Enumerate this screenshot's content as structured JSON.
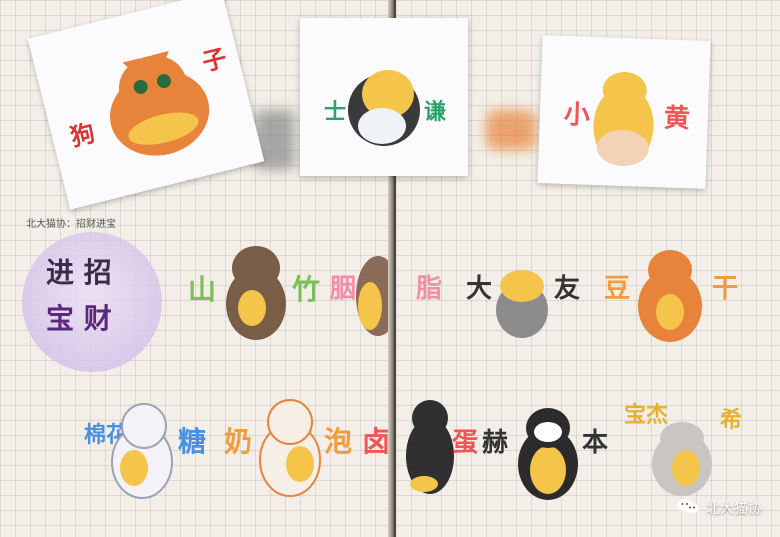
{
  "image": {
    "width": 780,
    "height": 537
  },
  "texts": {
    "note_title": "北大猫协：招财进宝",
    "sticker_1_left": "狗",
    "sticker_1_right": "子",
    "sticker_2_left": "士",
    "sticker_2_right": "谦",
    "sticker_3_left": "小",
    "sticker_3_right": "黄",
    "circle_top": "进 招",
    "circle_bottom": "宝 财",
    "row1_1_left": "山",
    "row1_1_right": "竹",
    "row1_2_left": "胭",
    "row1_2_right": "脂",
    "row1_3_left": "大",
    "row1_3_right": "友",
    "row1_4_left": "豆",
    "row1_4_right": "干",
    "row2_1_left": "棉花",
    "row2_1_right": "糖",
    "row2_2_left": "奶",
    "row2_2_right": "泡",
    "row2_3_left": "卤",
    "row2_3_right": "蛋",
    "row2_4_left": "赫",
    "row2_4_right": "本",
    "row2_5_left": "宝杰",
    "row2_5_right": "希",
    "watermark": "北大猫协"
  },
  "colors": {
    "paper": "#f3efe8",
    "grid": "#c9c2b7",
    "gutter_dark": "#3b3632",
    "orange_cat": "#e7833a",
    "purple_circle": "#d6c3ea"
  },
  "icons": {
    "watermark": "wechat-icon"
  }
}
